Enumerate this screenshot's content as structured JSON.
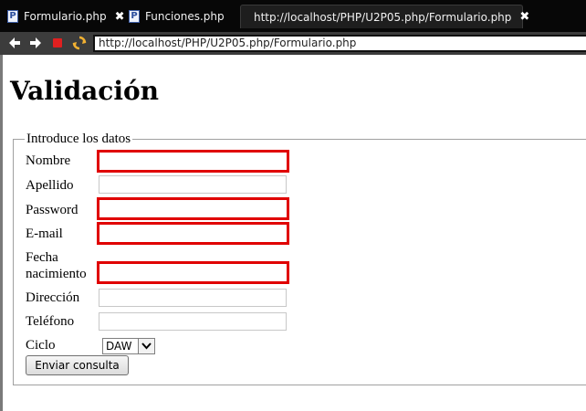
{
  "tabs": [
    {
      "label": "Formulario.php",
      "icon": "php-file-icon",
      "closable": true
    },
    {
      "label": "Funciones.php",
      "icon": "php-file-icon",
      "closable": false
    },
    {
      "label": "http://localhost/PHP/U2P05.php/Formulario.php",
      "icon": "globe-icon",
      "closable": true,
      "active": true
    }
  ],
  "toolbar": {
    "url": "http://localhost/PHP/U2P05.php/Formulario.php",
    "icons": [
      "back-arrow-icon",
      "forward-arrow-icon",
      "stop-icon",
      "refresh-icon"
    ]
  },
  "page": {
    "heading": "Validación",
    "legend": "Introduce los datos",
    "fields": [
      {
        "label": "Nombre",
        "value": "",
        "invalid": true
      },
      {
        "label": "Apellido",
        "value": "",
        "invalid": false
      },
      {
        "label": "Password",
        "value": "",
        "invalid": true
      },
      {
        "label": "E-mail",
        "value": "",
        "invalid": true
      },
      {
        "label_line1": "Fecha",
        "label_line2": "nacimiento",
        "value": "",
        "invalid": true
      },
      {
        "label": "Dirección",
        "value": "",
        "invalid": false
      },
      {
        "label": "Teléfono",
        "value": "",
        "invalid": false
      }
    ],
    "ciclo": {
      "label": "Ciclo",
      "selected": "DAW"
    },
    "submit_label": "Enviar consulta"
  },
  "colors": {
    "invalid_border": "#e00000",
    "titlebar": "#070707",
    "toolbar": "#3c3c3c"
  }
}
